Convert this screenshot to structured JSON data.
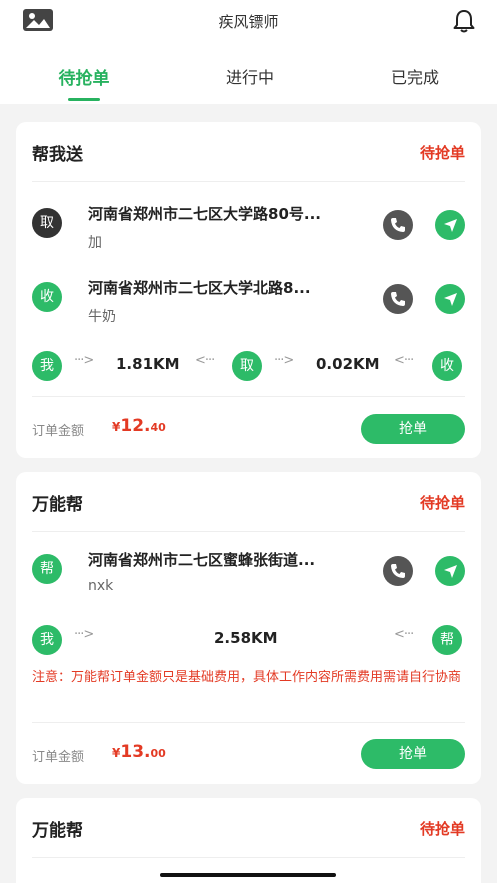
{
  "header": {
    "title": "疾风镖师",
    "left_icon": "image-icon",
    "right_icon": "bell-icon"
  },
  "tabs": [
    {
      "label": "待抢单",
      "active": true
    },
    {
      "label": "进行中",
      "active": false
    },
    {
      "label": "已完成",
      "active": false
    }
  ],
  "colors": {
    "accent": "#27b25f",
    "status": "#e33a24"
  },
  "orders": [
    {
      "type": "帮我送",
      "status": "待抢单",
      "pickup": {
        "badge": "取",
        "address": "河南省郑州市二七区大学路80号...",
        "note": "加"
      },
      "dropoff": {
        "badge": "收",
        "address": "河南省郑州市二七区大学北路8...",
        "note": "牛奶"
      },
      "route": {
        "me_badge": "我",
        "dist1": "1.81KM",
        "mid_badge": "取",
        "dist2": "0.02KM",
        "end_badge": "收"
      },
      "amount_label": "订单金额",
      "amount": {
        "currency": "¥",
        "integer": "12.",
        "decimal": "40"
      },
      "button": "抢单"
    },
    {
      "type": "万能帮",
      "status": "待抢单",
      "location": {
        "badge": "帮",
        "address": "河南省郑州市二七区蜜蜂张街道...",
        "note": "nxk"
      },
      "route": {
        "me_badge": "我",
        "dist": "2.58KM",
        "end_badge": "帮"
      },
      "notice": "注意：万能帮订单金额只是基础费用，具体工作内容所需费用需请自行协商",
      "amount_label": "订单金额",
      "amount": {
        "currency": "¥",
        "integer": "13.",
        "decimal": "00"
      },
      "button": "抢单"
    },
    {
      "type": "万能帮",
      "status": "待抢单"
    }
  ]
}
